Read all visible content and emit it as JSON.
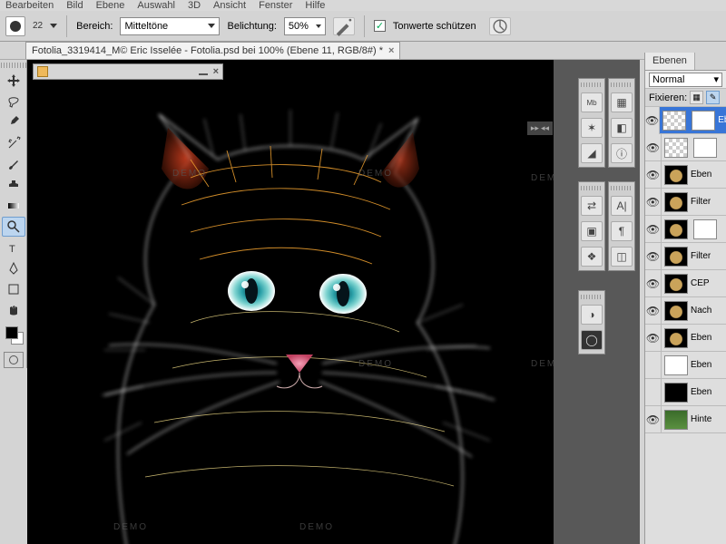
{
  "menu": {
    "items": [
      "Bearbeiten",
      "Bild",
      "Ebene",
      "Auswahl",
      "3D",
      "Ansicht",
      "Fenster",
      "Hilfe"
    ]
  },
  "options": {
    "brush_size": "22",
    "bereich_label": "Bereich:",
    "bereich_value": "Mitteltöne",
    "belichtung_label": "Belichtung:",
    "belichtung_value": "50%",
    "tonwerte_label": "Tonwerte schützen",
    "tonwerte_checked": true
  },
  "document_tab": "Fotolia_3319414_M© Eric Isselée - Fotolia.psd bei 100% (Ebene 11, RGB/8#) *",
  "demo_text": "DEMO",
  "layers_panel": {
    "tab": "Ebenen",
    "blend_mode": "Normal",
    "lock_label": "Fixieren:",
    "layers": [
      {
        "name": "Ebe",
        "thumb": "checker",
        "sel": true,
        "vis": true,
        "mask": "white"
      },
      {
        "name": "",
        "thumb": "checker",
        "vis": true,
        "mask": "white"
      },
      {
        "name": "Eben",
        "thumb": "cat",
        "vis": true
      },
      {
        "name": "Filter",
        "thumb": "cat",
        "vis": true
      },
      {
        "name": "",
        "thumb": "cat",
        "vis": true,
        "mask": "white"
      },
      {
        "name": "Filter",
        "thumb": "cat",
        "vis": true
      },
      {
        "name": "CEP",
        "thumb": "cat",
        "vis": true
      },
      {
        "name": "Nach",
        "thumb": "cat",
        "vis": true
      },
      {
        "name": "Eben",
        "thumb": "cat",
        "vis": true
      },
      {
        "name": "Eben",
        "thumb": "white",
        "vis": false
      },
      {
        "name": "Eben",
        "thumb": "black",
        "vis": false
      },
      {
        "name": "Hinte",
        "thumb": "green",
        "vis": true
      }
    ]
  },
  "tools": [
    "move",
    "lasso",
    "eyedropper",
    "wand",
    "crop",
    "brush",
    "clone",
    "gradient",
    "dodge",
    "zoom",
    "type",
    "pen",
    "rect",
    "hand"
  ]
}
